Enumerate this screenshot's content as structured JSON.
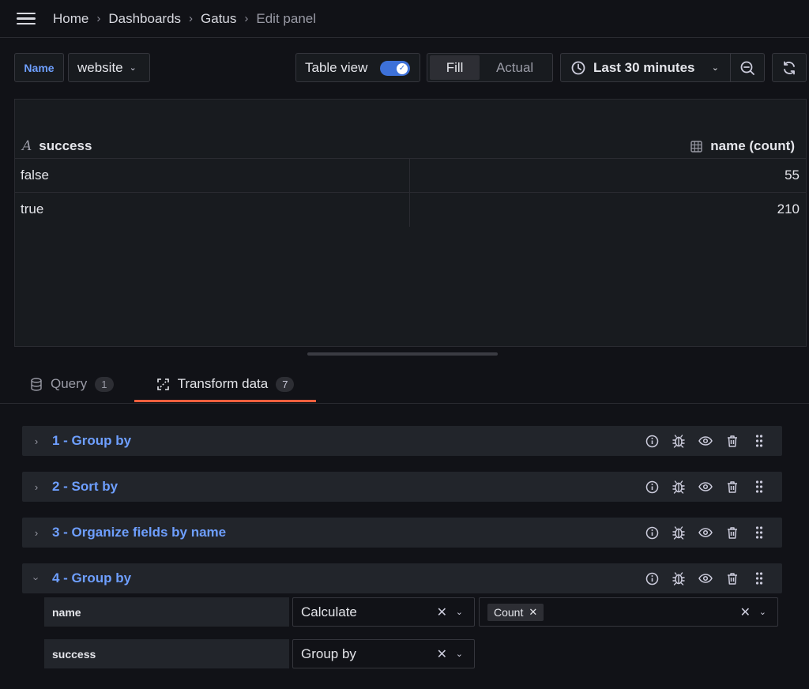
{
  "breadcrumb": [
    "Home",
    "Dashboards",
    "Gatus",
    "Edit panel"
  ],
  "variable": {
    "label": "Name",
    "value": "website"
  },
  "toolbar": {
    "table_view_label": "Table view",
    "table_view_on": true,
    "fill_label": "Fill",
    "actual_label": "Actual",
    "time_range": "Last 30 minutes"
  },
  "table": {
    "columns": [
      "success",
      "name (count)"
    ],
    "rows": [
      [
        "false",
        "55"
      ],
      [
        "true",
        "210"
      ]
    ]
  },
  "tabs": {
    "query": {
      "label": "Query",
      "count": "1"
    },
    "transform": {
      "label": "Transform data",
      "count": "7"
    }
  },
  "transformations": [
    {
      "title": "1 - Group by",
      "expanded": false
    },
    {
      "title": "2 - Sort by",
      "expanded": false
    },
    {
      "title": "3 - Organize fields by name",
      "expanded": false
    },
    {
      "title": "4 - Group by",
      "expanded": true
    }
  ],
  "group_by_config": [
    {
      "field": "name",
      "mode": "Calculate",
      "calculations": [
        "Count"
      ]
    },
    {
      "field": "success",
      "mode": "Group by"
    }
  ],
  "colors": {
    "accent": "#6e9fff",
    "tab_underline": "#f55f3e",
    "switch": "#3d71d9"
  }
}
